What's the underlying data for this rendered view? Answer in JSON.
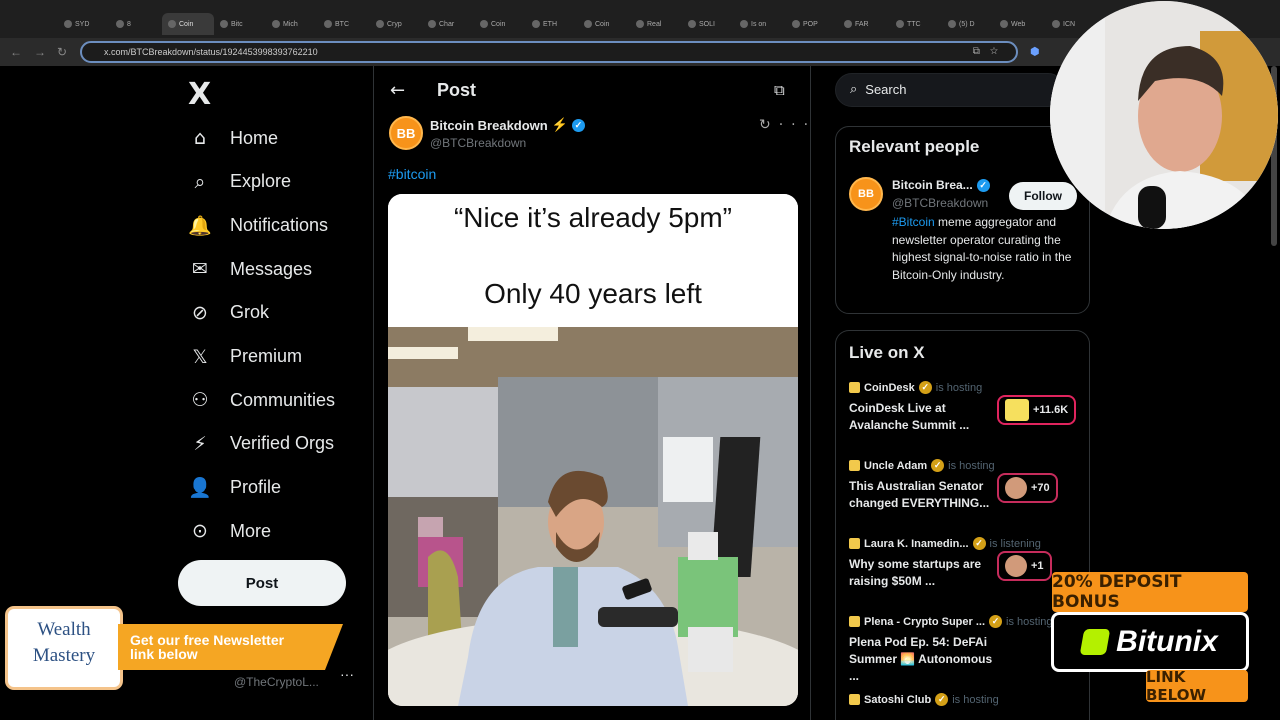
{
  "browser": {
    "tabs": [
      "SYD",
      "8",
      "Coin",
      "Bitc",
      "Mich",
      "BTC",
      "Cryp",
      "Char",
      "Coin",
      "ETH",
      "Coin",
      "Real",
      "SOLI",
      "Is on",
      "POP",
      "FAR",
      "TTC",
      "(5) D",
      "Web",
      "ICN"
    ],
    "url": "x.com/BTCBreakdown/status/1924453998393762210"
  },
  "sidebar": {
    "logo": "X",
    "items": [
      {
        "label": "Home",
        "icon": "home-icon",
        "glyph": "⌂"
      },
      {
        "label": "Explore",
        "icon": "search-icon",
        "glyph": "⌕"
      },
      {
        "label": "Notifications",
        "icon": "bell-icon",
        "glyph": "🔔"
      },
      {
        "label": "Messages",
        "icon": "envelope-icon",
        "glyph": "✉"
      },
      {
        "label": "Grok",
        "icon": "grok-icon",
        "glyph": "⊘"
      },
      {
        "label": "Premium",
        "icon": "x-premium-icon",
        "glyph": "𝕏"
      },
      {
        "label": "Communities",
        "icon": "people-icon",
        "glyph": "⚇"
      },
      {
        "label": "Verified Orgs",
        "icon": "lightning-icon",
        "glyph": "⚡"
      },
      {
        "label": "Profile",
        "icon": "person-icon",
        "glyph": "👤"
      },
      {
        "label": "More",
        "icon": "more-circle-icon",
        "glyph": "⊙"
      }
    ],
    "post_label": "Post",
    "account_handle": "@TheCryptoL..."
  },
  "post": {
    "header_title": "Post",
    "author_name": "Bitcoin Breakdown",
    "author_initials": "BB",
    "author_handle": "@BTCBreakdown",
    "hashtag": "#bitcoin",
    "meme_line1": "“Nice it’s already 5pm”",
    "meme_line2": "Only 40 years left"
  },
  "right": {
    "search_placeholder": "Search",
    "relevant_title": "Relevant people",
    "person": {
      "name": "Bitcoin Brea...",
      "handle": "@BTCBreakdown",
      "follow_label": "Follow",
      "bio_tag": "#Bitcoin",
      "bio_rest": " meme aggregator and newsletter operator curating the highest signal-to-noise ratio in the Bitcoin-Only industry."
    },
    "live_title": "Live on X",
    "live": [
      {
        "host": "CoinDesk",
        "status": "is hosting",
        "title": "CoinDesk Live at Avalanche Summit ...",
        "count": "+11.6K"
      },
      {
        "host": "Uncle Adam",
        "status": "is hosting",
        "title": "This Australian Senator changed EVERYTHING...",
        "count": "+70"
      },
      {
        "host": "Laura K. Inamedin...",
        "status": "is listening",
        "title": "Why some startups are raising $50M ...",
        "count": "+1"
      },
      {
        "host": "Plena - Crypto Super ...",
        "status": "is hosting",
        "title": "Plena Pod Ep. 54: DeFAi Summer 🌅 Autonomous ...",
        "count": ""
      },
      {
        "host": "Satoshi Club",
        "status": "is hosting",
        "title": "",
        "count": ""
      }
    ]
  },
  "overlays": {
    "wm_line1": "Wealth",
    "wm_line2": "Mastery",
    "newsletter_line1": "Get our free Newsletter",
    "newsletter_line2": "link below",
    "deposit_label": "20% DEPOSIT BONUS",
    "brand": "Bitunix",
    "link_below": "LINK BELOW"
  },
  "colors": {
    "accent": "#1d9bf0",
    "bitcoin": "#f7931a",
    "background": "#000000"
  }
}
